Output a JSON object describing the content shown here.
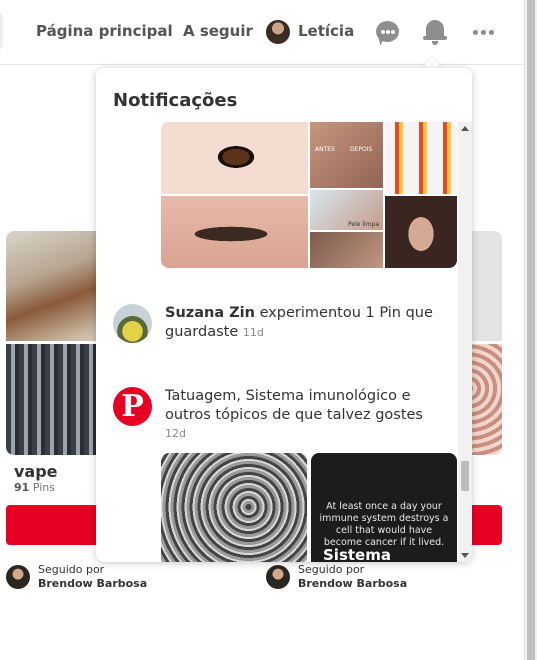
{
  "header": {
    "home_label": "Página principal",
    "following_label": "A seguir",
    "profile_name": "Letícia",
    "icons": [
      "chat-icon",
      "bell-icon",
      "more-icon"
    ]
  },
  "boards": [
    {
      "title": "vape",
      "count": "91",
      "count_unit": "Pins",
      "followed_by_label": "Seguido por",
      "followed_by_name": "Brendow Barbosa"
    },
    {
      "followed_by_label": "Seguido por",
      "followed_by_name": "Brendow Barbosa"
    }
  ],
  "notifications": {
    "title": "Notificações",
    "items": [
      {
        "user": "Suzana Zin",
        "text": "experimentou 1 Pin que guardaste",
        "time": "11d"
      },
      {
        "text": "Tatuagem, Sistema imunológico e outros tópicos de que talvez gostes",
        "time": "12d"
      }
    ],
    "mosaic_labels": {
      "antes": "ANTES",
      "depois": "DEPOIS",
      "pele": "Pele limpa"
    },
    "tiles": {
      "cancer_quote": "At least once a day your immune system destroys a cell that would have become cancer if it lived.",
      "sistema_label": "Sistema"
    }
  },
  "colors": {
    "accent": "#e60023",
    "text": "#333333",
    "muted": "#888888"
  }
}
